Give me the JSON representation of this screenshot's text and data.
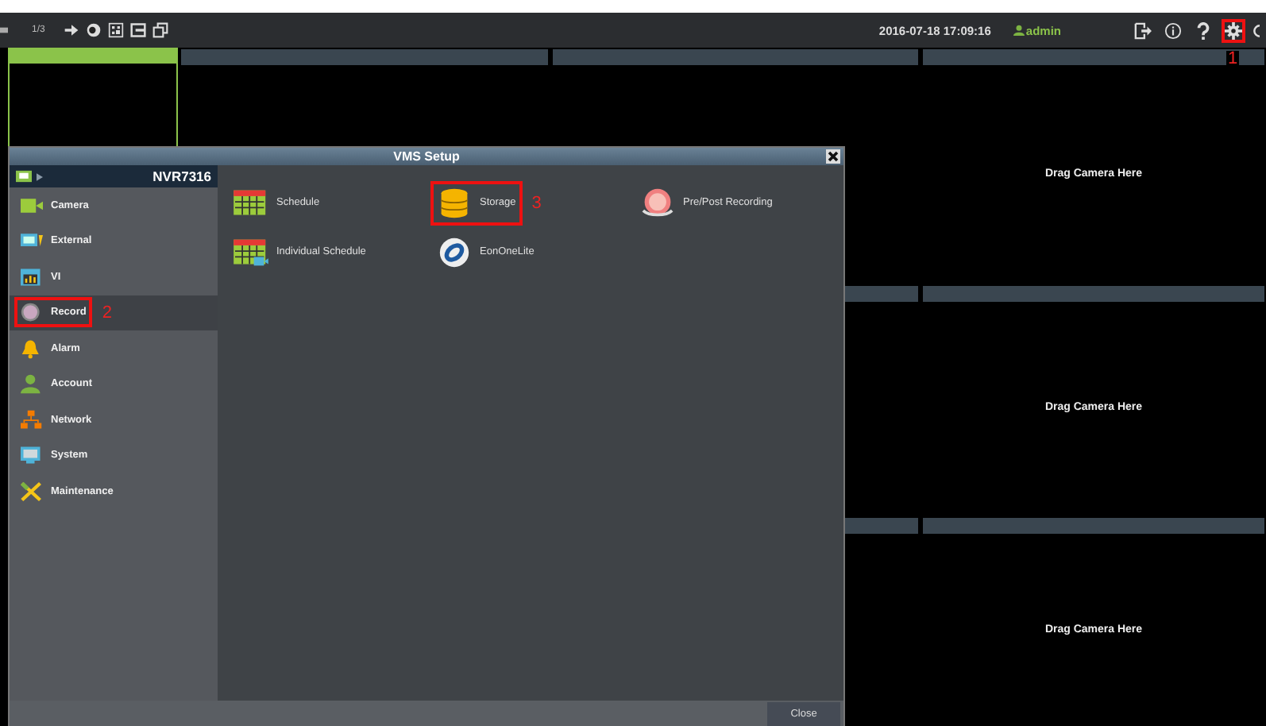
{
  "toolbar": {
    "page": "1/3",
    "datetime": "2016-07-18 17:09:16",
    "user": "admin",
    "settings": {
      "highlighted": true,
      "annotation": "1"
    }
  },
  "camera_grid": {
    "rows": [
      {
        "tiles": [
          {
            "selected": true
          },
          {
            "selected": false
          },
          {
            "selected": false
          },
          {
            "selected": false,
            "hint": "Drag Camera Here"
          }
        ]
      },
      {
        "tiles": [
          {
            "selected": false
          },
          {
            "selected": false,
            "hint": "Drag Camera Here"
          }
        ]
      },
      {
        "tiles": [
          {
            "selected": false
          },
          {
            "selected": false,
            "hint": "Drag Camera Here"
          }
        ]
      }
    ]
  },
  "dialog": {
    "title": "VMS Setup",
    "device": "NVR7316",
    "sidebar": [
      {
        "kind": "camera",
        "label": "Camera",
        "selected": false,
        "highlighted": false
      },
      {
        "kind": "external",
        "label": "External",
        "selected": false,
        "highlighted": false
      },
      {
        "kind": "vi",
        "label": "VI",
        "selected": false,
        "highlighted": false
      },
      {
        "kind": "record",
        "label": "Record",
        "selected": true,
        "highlighted": true,
        "annotation": "2"
      },
      {
        "kind": "alarm",
        "label": "Alarm",
        "selected": false,
        "highlighted": false
      },
      {
        "kind": "account",
        "label": "Account",
        "selected": false,
        "highlighted": false
      },
      {
        "kind": "network",
        "label": "Network",
        "selected": false,
        "highlighted": false
      },
      {
        "kind": "system",
        "label": "System",
        "selected": false,
        "highlighted": false
      },
      {
        "kind": "maintenance",
        "label": "Maintenance",
        "selected": false,
        "highlighted": false
      }
    ],
    "items": [
      {
        "kind": "schedule",
        "label": "Schedule",
        "highlighted": false
      },
      {
        "kind": "storage",
        "label": "Storage",
        "highlighted": true,
        "annotation": "3"
      },
      {
        "kind": "prepost",
        "label": "Pre/Post Recording",
        "highlighted": false
      },
      {
        "kind": "individual",
        "label": "Individual Schedule",
        "highlighted": false
      },
      {
        "kind": "eon",
        "label": "EonOneLite",
        "highlighted": false
      }
    ],
    "close": "Close"
  }
}
